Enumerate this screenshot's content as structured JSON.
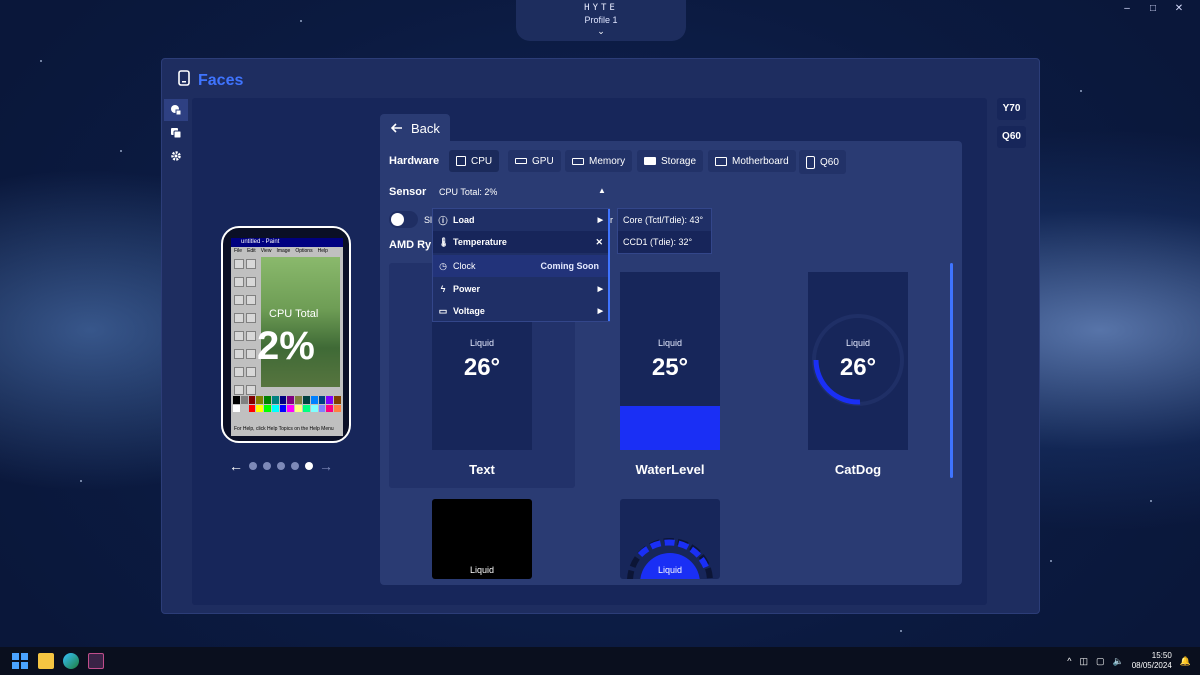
{
  "header": {
    "brand": "HYTE",
    "profile": "Profile 1",
    "chevron": "⌄"
  },
  "window_controls": [
    "–",
    "□",
    "✕"
  ],
  "app": {
    "title": "Faces"
  },
  "devices": [
    "Y70",
    "Q60"
  ],
  "back_label": "Back",
  "hardware": {
    "label": "Hardware",
    "tabs": [
      "CPU",
      "GPU",
      "Memory",
      "Storage",
      "Motherboard",
      "Q60"
    ],
    "active": "CPU"
  },
  "sensor": {
    "label": "Sensor",
    "value": "CPU Total: 2%"
  },
  "toggle_label": "Sl",
  "toggle_label_right": "r",
  "device_name": "AMD Ry",
  "menu": {
    "items": [
      {
        "icon": "info-icon",
        "label": "Load",
        "arrow": "▶"
      },
      {
        "icon": "thermometer-icon",
        "label": "Temperature",
        "arrow": "✕"
      },
      {
        "icon": "clock-icon",
        "label": "Clock",
        "note": "Coming Soon"
      },
      {
        "icon": "bolt-icon",
        "label": "Power",
        "arrow": "▶"
      },
      {
        "icon": "battery-icon",
        "label": "Voltage",
        "arrow": "▶"
      }
    ]
  },
  "submenu": [
    "Core (Tctl/Tdie): 43°",
    "CCD1 (Tdie): 32°"
  ],
  "faces": [
    {
      "name": "Text",
      "label": "Liquid",
      "value": "26°"
    },
    {
      "name": "WaterLevel",
      "label": "Liquid",
      "value": "25°",
      "level": 0.25
    },
    {
      "name": "CatDog",
      "label": "Liquid",
      "value": "26°",
      "arc": 0.3
    },
    {
      "name": "",
      "label": "Liquid",
      "value": ""
    },
    {
      "name": "",
      "label": "Liquid",
      "value": ""
    }
  ],
  "preview": {
    "window_title": "untitled - Paint",
    "menus": [
      "File",
      "Edit",
      "View",
      "Image",
      "Options",
      "Help"
    ],
    "status": "For Help, click Help Topics on the Help Menu",
    "metric_label": "CPU Total",
    "metric_value": "2%"
  },
  "pager": {
    "prev": "←",
    "next": "→",
    "count": 5,
    "active": 5
  },
  "tray": {
    "chevron": "^",
    "time": "15:50",
    "date": "08/05/2024"
  },
  "colors": {
    "accent": "#3f74ff",
    "panel": "#1e2d60",
    "water": "#1a2ff5"
  }
}
